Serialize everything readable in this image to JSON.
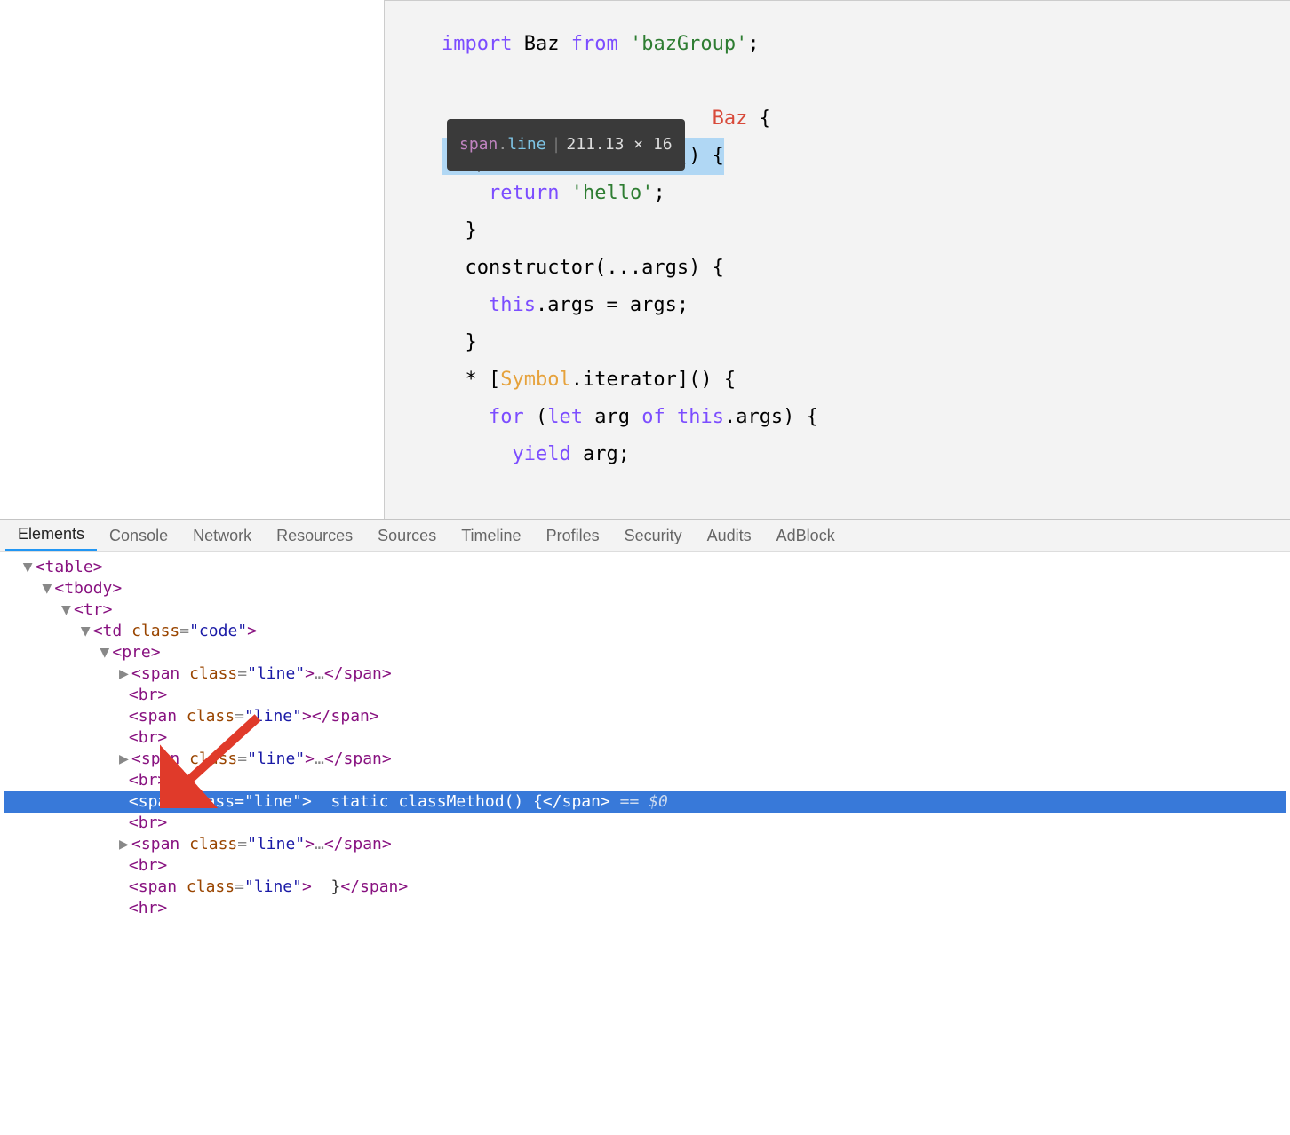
{
  "code": {
    "l1_import": "import",
    "l1_baz": " Baz ",
    "l1_from": "from",
    "l1_space": " ",
    "l1_str": "'bazGroup'",
    "l1_semi": ";",
    "l3_pre": "                       ",
    "l3_cls": "Baz",
    "l3_brace": " {",
    "l4_text": "  static classMethod() {",
    "l5_pre": "    ",
    "l5_ret": "return",
    "l5_sp": " ",
    "l5_str": "'hello'",
    "l5_semi": ";",
    "l6_text": "  }",
    "l7_text": "  constructor(...args) {",
    "l8_pre": "    ",
    "l8_this": "this",
    "l8_rest": ".args = args;",
    "l9_text": "  }",
    "l10_pre": "  * [",
    "l10_sym": "Symbol",
    "l10_rest": ".iterator]() {",
    "l11_pre": "    ",
    "l11_for": "for",
    "l11_sp1": " (",
    "l11_let": "let",
    "l11_sp2": " arg ",
    "l11_of": "of",
    "l11_sp3": " ",
    "l11_this": "this",
    "l11_rest": ".args) {",
    "l12_pre": "      ",
    "l12_yield": "yield",
    "l12_rest": " arg;"
  },
  "tooltip": {
    "tag": "span",
    "dot": ".",
    "cls": "line",
    "dims": "211.13 × 16"
  },
  "tabs": [
    "Elements",
    "Console",
    "Network",
    "Resources",
    "Sources",
    "Timeline",
    "Profiles",
    "Security",
    "Audits",
    "AdBlock"
  ],
  "dom": {
    "table_open": "<table>",
    "tbody_open": "<tbody>",
    "tr_open": "<tr>",
    "td_open_pre": "<td ",
    "td_attr": "class",
    "td_val": "\"code\"",
    "td_close": ">",
    "pre_open": "<pre>",
    "span_open_pre": "<span ",
    "span_attr": "class",
    "span_val": "\"line\"",
    "span_close_tag": ">",
    "ellipsis": "…",
    "span_end": "</span>",
    "br": "<br>",
    "empty_span_text": "",
    "sel_text": "  static classMethod() {",
    "eq_zero": " == $0",
    "closing_brace_text": "  }"
  }
}
